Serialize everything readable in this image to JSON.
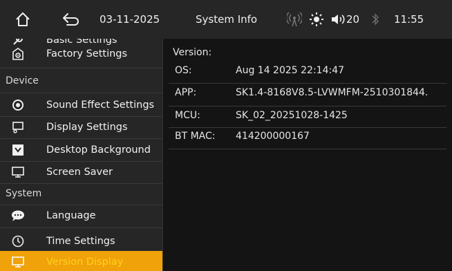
{
  "statusbar": {
    "date": "03-11-2025",
    "title": "System Info",
    "volume": "20",
    "time": "11:55",
    "icons": {
      "home": "home-icon",
      "back": "back-arrow-icon",
      "radio": "radio-signal-icon",
      "brightness": "sun-icon",
      "volume": "speaker-icon",
      "bluetooth": "bluetooth-icon"
    }
  },
  "sidebar": {
    "partial_item": {
      "label": "Basic Settings",
      "icon": "wrench-icon"
    },
    "items_general": [
      {
        "label": "Factory Settings",
        "icon": "factory-icon"
      }
    ],
    "sections": {
      "device": "Device",
      "system": "System"
    },
    "items_device": [
      {
        "label": "Sound Effect Settings",
        "icon": "sound-effect-icon"
      },
      {
        "label": "Display Settings",
        "icon": "display-settings-icon"
      },
      {
        "label": "Desktop Background",
        "icon": "desktop-background-icon"
      },
      {
        "label": "Screen Saver",
        "icon": "screen-saver-icon"
      }
    ],
    "items_system": [
      {
        "label": "Language",
        "icon": "language-bubble-icon"
      },
      {
        "label": "Time Settings",
        "icon": "clock-icon"
      },
      {
        "label": "Version Display",
        "icon": "monitor-icon",
        "active": true
      }
    ],
    "active_color": "#f0a20a",
    "active_text_color": "#ffd21a"
  },
  "content": {
    "heading": "Version:",
    "rows": [
      {
        "key": "OS:",
        "value": "Aug 14 2025 22:14:47"
      },
      {
        "key": "APP:",
        "value": "SK1.4-8168V8.5-LVWMFM-2510301844."
      },
      {
        "key": "MCU:",
        "value": "SK_02_20251028-1425"
      },
      {
        "key": "BT MAC:",
        "value": "414200000167"
      }
    ]
  }
}
